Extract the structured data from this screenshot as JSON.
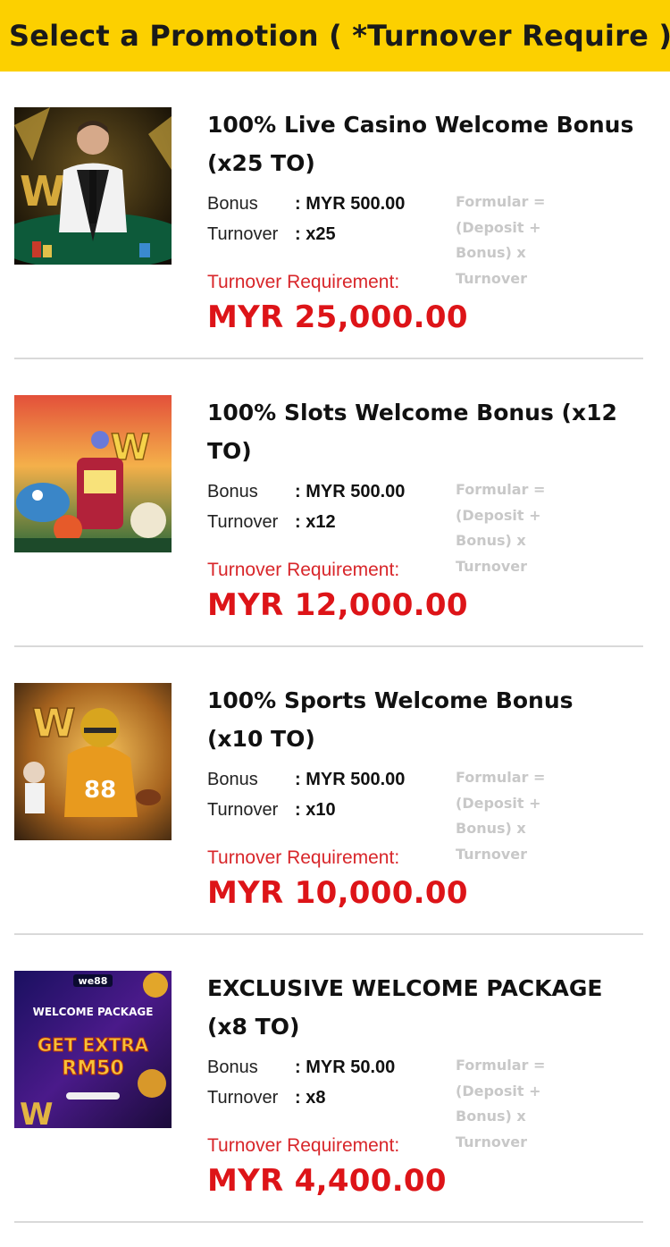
{
  "header": {
    "title": "Select a Promotion ( *Turnover Require )"
  },
  "labels": {
    "bonus": "Bonus",
    "turnover": "Turnover",
    "formula": [
      "Formular =",
      "(Deposit +",
      "Bonus) x",
      "Turnover"
    ],
    "requirement": "Turnover Requirement:"
  },
  "promotions": [
    {
      "title": "100% Live Casino Welcome Bonus (x25 TO)",
      "bonus": ": MYR 500.00",
      "turnover": ": x25",
      "requirement": "MYR 25,000.00",
      "image_icon": "live-casino-dealer-image"
    },
    {
      "title": "100% Slots Welcome Bonus (x12 TO)",
      "bonus": ": MYR 500.00",
      "turnover": ": x12",
      "requirement": "MYR 12,000.00",
      "image_icon": "slots-characters-image"
    },
    {
      "title": "100% Sports Welcome Bonus (x10 TO)",
      "bonus": ": MYR 500.00",
      "turnover": ": x10",
      "requirement": "MYR 10,000.00",
      "image_icon": "football-player-image"
    },
    {
      "title": "EXCLUSIVE WELCOME PACKAGE (x8 TO)",
      "bonus": ": MYR 50.00",
      "turnover": ": x8",
      "requirement": "MYR 4,400.00",
      "image_icon": "welcome-package-banner-image",
      "image_text": {
        "brand": "we88",
        "heading": "WELCOME PACKAGE",
        "line1": "GET EXTRA",
        "line2": "RM50"
      }
    }
  ],
  "colors": {
    "header_bg": "#fcd000",
    "requirement_red": "#dd1418",
    "formula_gray": "#c8c8c8",
    "divider": "#d9d9d9"
  }
}
